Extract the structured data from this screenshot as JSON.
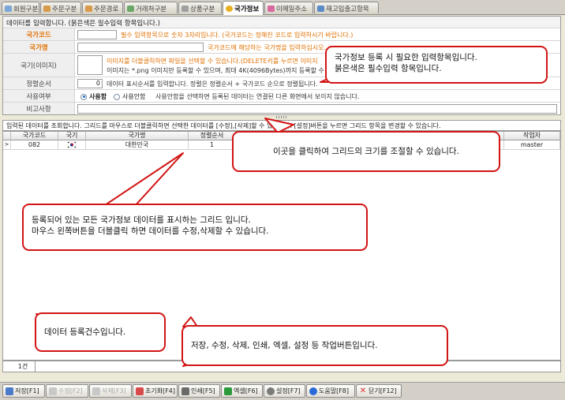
{
  "tabs": [
    {
      "label": "회원구분",
      "color": "#7aa6d8"
    },
    {
      "label": "주문구분",
      "color": "#d89a4a"
    },
    {
      "label": "주문경로",
      "color": "#d89a4a"
    },
    {
      "label": "거래처구분",
      "color": "#6aa86a"
    },
    {
      "label": "상품구분",
      "color": "#a0a0a0"
    },
    {
      "label": "국가정보",
      "color": "#e8b020",
      "active": true
    },
    {
      "label": "이메일주소",
      "color": "#d86aa0"
    },
    {
      "label": "재고입출고항목",
      "color": "#5a8ac8"
    }
  ],
  "form": {
    "header": "데이터를 입력합니다. (붉은색은 필수입력 항목입니다.)",
    "code_label": "국가코드",
    "code_hint": "필수 입력항목으로 숫자 3자리입니다. (국가코드는 정해진 코드로 입력하시기 바랍니다.)",
    "name_label": "국가명",
    "name_hint": "국가코드에 해당하는 국가명을 입력하십시오.",
    "image_label": "국기(이미지)",
    "image_hint1": "이미지를 더블클릭하면 파일을 선택할 수 있습니다.(DELETE키를 누르면 이미지",
    "image_hint2": "이미지는 *.png 이미지만 등록할 수 있으며, 최대 4K(4096Bytes)까지 등록할 수 있",
    "order_label": "정렬순서",
    "order_value": "0",
    "order_hint": "데이터 표시순서를 입력합니다. 정렬은 정렬순서 + 국가코드 순으로 정렬됩니다.",
    "use_label": "사용여부",
    "use_yes": "사용함",
    "use_no": "사용안함",
    "use_hint": "사용안함을 선택하면 등록된 데이터는 연결된 다른 화면에서 보이지 않습니다.",
    "note_label": "비고사항"
  },
  "grid": {
    "info": "입력된 데이터를 조회합니다. 그리드를 마우스로 더블클릭하면 선택한 데이터를 [수정],[삭제]할 수 있습니다. [설정]버튼을 누르면 그리드 항목을 변경할 수 있습니다.",
    "columns": [
      "국가코드",
      "국기",
      "국가명",
      "정렬순서",
      "작업자"
    ],
    "rows": [
      {
        "code": "082",
        "flag": "kr",
        "name": "대한민국",
        "order": "1",
        "user": "master"
      }
    ],
    "count": "1건"
  },
  "toolbar": [
    {
      "label": "저장[F1]",
      "icon": "save-icon",
      "color": "#4a7ac8",
      "enabled": true
    },
    {
      "label": "수정[F2]",
      "icon": "edit-icon",
      "color": "#b0b0b0",
      "enabled": false
    },
    {
      "label": "삭제[F3]",
      "icon": "delete-icon",
      "color": "#b0b0b0",
      "enabled": false
    },
    {
      "label": "초기화[F4]",
      "icon": "reset-icon",
      "color": "#d84a4a",
      "enabled": true
    },
    {
      "label": "인쇄[F5]",
      "icon": "print-icon",
      "color": "#6a6a6a",
      "enabled": true
    },
    {
      "label": "엑셀[F6]",
      "icon": "excel-icon",
      "color": "#2a9a3a",
      "enabled": true
    },
    {
      "label": "설정[F7]",
      "icon": "settings-icon",
      "color": "#7a7a7a",
      "enabled": true
    },
    {
      "label": "도움말[F8]",
      "icon": "help-icon",
      "color": "#2a6ad8",
      "enabled": true
    },
    {
      "label": "닫기[F12]",
      "icon": "close-icon",
      "color": "#d82a2a",
      "enabled": true
    }
  ],
  "callouts": {
    "required": [
      "국가정보 등록 시 필요한 입력항목입니다.",
      "붉은색은 필수입력 항목입니다."
    ],
    "resize": "이곳을 클릭하여 그리드의 크기를 조절할 수 있습니다.",
    "grid": [
      "등록되어 있는 모든 국가정보 데이터를 표시하는 그리드 입니다.",
      "마우스 왼쪽버튼을 더블클릭 하면 데이터를 수정,삭제할 수 있습니다."
    ],
    "count": "데이터 등록건수입니다.",
    "buttons": "저장, 수정, 삭제, 인쇄, 엑셀, 설정 등 작업버튼입니다."
  }
}
